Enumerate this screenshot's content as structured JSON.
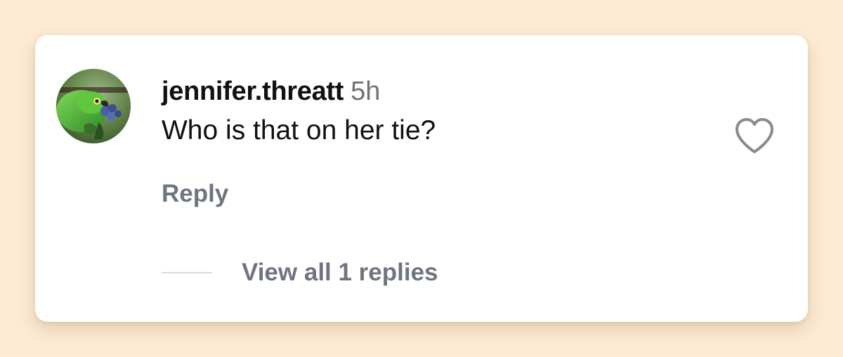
{
  "comment": {
    "username": "jennifer.threatt",
    "timestamp": "5h",
    "text": "Who is that on her tie?",
    "reply_label": "Reply",
    "view_replies_label": "View all 1 replies"
  },
  "icons": {
    "avatar": "parrot-avatar-photo",
    "like": "heart-outline-icon"
  },
  "colors": {
    "background": "#fdebd3",
    "card": "#ffffff",
    "primary_text": "#111111",
    "secondary_text": "#6f7580",
    "timestamp": "#737373",
    "heart_stroke": "#8a8a8a"
  }
}
